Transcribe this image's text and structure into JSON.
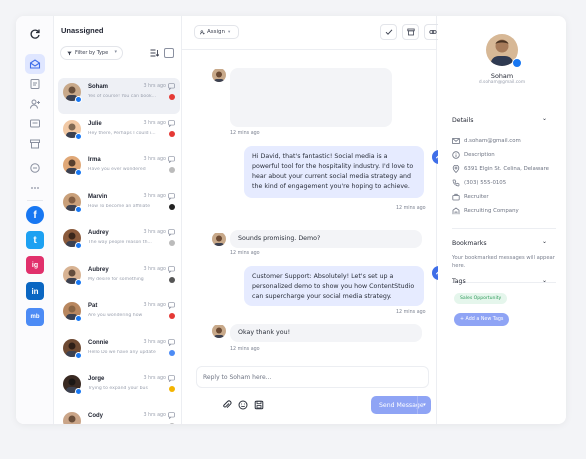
{
  "colors": {
    "accent": "#3f6ee8",
    "facebook": "#1877f2",
    "twitter": "#1da1f2",
    "instagram": "#e1306c",
    "linkedin": "#0a66c2"
  },
  "rail": {
    "icons": [
      "refresh-icon",
      "inbox-icon",
      "document-icon",
      "assign-user-icon",
      "message-icon",
      "archive-icon",
      "chat-icon",
      "more-icon"
    ],
    "platforms": [
      "f",
      "t",
      "ig",
      "in",
      "mb"
    ]
  },
  "list": {
    "title": "Unassigned",
    "filter_label": "Filter by Type",
    "conversations": [
      {
        "name": "Soham",
        "preview": "Yes of course! You can book...",
        "time": "3 hrs ago"
      },
      {
        "name": "Julie",
        "preview": "Hey there, Perhaps I could i...",
        "time": "3 hrs ago"
      },
      {
        "name": "Irma",
        "preview": "Have you ever wondered",
        "time": "3 hrs ago"
      },
      {
        "name": "Marvin",
        "preview": "How To become an affiliate",
        "time": "3 hrs ago"
      },
      {
        "name": "Audrey",
        "preview": "The way people reason th...",
        "time": "3 hrs ago"
      },
      {
        "name": "Aubrey",
        "preview": "My desire for something",
        "time": "3 hrs ago"
      },
      {
        "name": "Pat",
        "preview": "Are you wondering how",
        "time": "3 hrs ago"
      },
      {
        "name": "Connie",
        "preview": "Hello Do we have any update b...",
        "time": "3 hrs ago"
      },
      {
        "name": "Jorge",
        "preview": "Trying to expand your bus",
        "time": "3 hrs ago"
      },
      {
        "name": "Cody",
        "preview": "",
        "time": "3 hrs ago"
      }
    ]
  },
  "chat": {
    "assign_label": "Assign",
    "messages": [
      {
        "text": "",
        "time": "12 mins ago"
      },
      {
        "text": "Hi David, that's fantastic! Social media is a powerful tool for the hospitality industry. I'd love to hear about your current social media strategy and the kind of engagement you're hoping to achieve.",
        "time": "12 mins ago"
      },
      {
        "text": "Sounds promising. Demo?",
        "time": "12 mins ago"
      },
      {
        "text": "Customer Support: Absolutely! Let's set up a personalized demo to show you how ContentStudio can supercharge your social media strategy.",
        "time": "12 mins ago"
      },
      {
        "text": "Okay thank you!",
        "time": "12 mins ago"
      }
    ],
    "reply_placeholder": "Reply to Soham here...",
    "send_label": "Send Message"
  },
  "panel": {
    "name": "Soham",
    "email_small": "d.soham@gmail.com",
    "details_title": "Details",
    "details": {
      "email": "d.soham@gmail.com",
      "description": "Description",
      "address": "6391 Elgin St. Celina, Delaware",
      "phone": "(303) 555-0105",
      "role": "Recruiter",
      "company": "Recruiting Company"
    },
    "bookmarks_title": "Bookmarks",
    "bookmarks_text": "Your bookmarked messages will appear here.",
    "tags_title": "Tags",
    "tag": "Sales Opportunity",
    "add_tag_label": "+ Add a New Tags"
  }
}
